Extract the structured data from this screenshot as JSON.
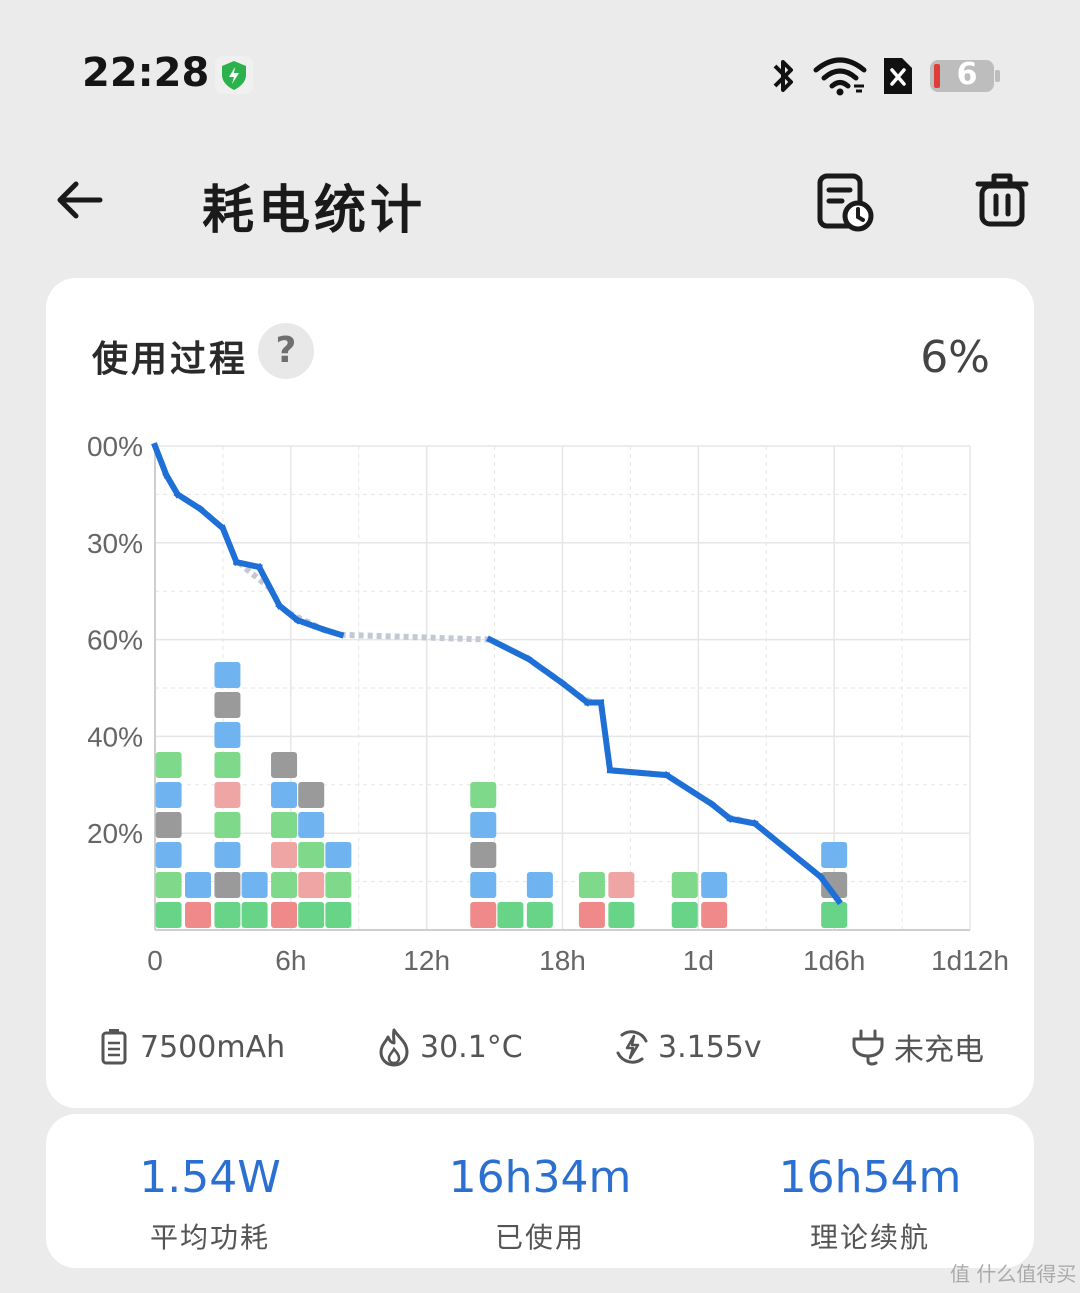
{
  "status_bar": {
    "time": "22:28",
    "battery_level": "6",
    "icons": [
      "shield-check-icon",
      "bluetooth-icon",
      "wifi-icon",
      "sim-error-icon",
      "battery-low-icon"
    ]
  },
  "header": {
    "title": "耗电统计",
    "back_icon": "arrow-left-icon",
    "actions": [
      "history-record-icon",
      "trash-icon"
    ]
  },
  "usage": {
    "title": "使用过程",
    "help": "?",
    "current_percent": "6%"
  },
  "chart_data": {
    "type": "line",
    "xlabel": "",
    "ylabel": "",
    "x_ticks": [
      "0",
      "6h",
      "12h",
      "18h",
      "1d",
      "1d6h",
      "1d12h"
    ],
    "y_ticks": [
      "00%",
      "30%",
      "60%",
      "40%",
      "20%"
    ],
    "xlim_hours": [
      0,
      36
    ],
    "ylim": [
      0,
      100
    ],
    "series": [
      {
        "values_hours": [
          0,
          0.5,
          1,
          2,
          3,
          3.6,
          4.6,
          5.5,
          6.3,
          7.5,
          8.2,
          11,
          14.8,
          16.5,
          18,
          19.1,
          19.7,
          20.1,
          22.6,
          24.6,
          25.4,
          26.5,
          29.4,
          30.2
        ],
        "values_percent": [
          100,
          94,
          90,
          87,
          83,
          76,
          75,
          67,
          64,
          62,
          61,
          60,
          60,
          56,
          51,
          47,
          47,
          33,
          32,
          26,
          23,
          22,
          11,
          6
        ],
        "dashed_idle_segments_hours": [
          [
            3.7,
            5.1
          ],
          [
            5.9,
            7.4
          ],
          [
            8.2,
            14.8
          ],
          [
            18.7,
            19.3
          ],
          [
            20.2,
            22.5
          ],
          [
            25.3,
            26.3
          ]
        ]
      }
    ],
    "app_markers": [
      {
        "hour": 0.6,
        "stack": 5
      },
      {
        "hour": 1.9,
        "stack": 1
      },
      {
        "hour": 3.2,
        "stack": 8
      },
      {
        "hour": 4.4,
        "stack": 1
      },
      {
        "hour": 5.7,
        "stack": 5
      },
      {
        "hour": 6.9,
        "stack": 4
      },
      {
        "hour": 8.1,
        "stack": 2
      },
      {
        "hour": 14.5,
        "stack": 4
      },
      {
        "hour": 15.7,
        "stack": 0
      },
      {
        "hour": 17.0,
        "stack": 1
      },
      {
        "hour": 19.3,
        "stack": 1
      },
      {
        "hour": 20.6,
        "stack": 1
      },
      {
        "hour": 23.4,
        "stack": 1
      },
      {
        "hour": 24.7,
        "stack": 1
      },
      {
        "hour": 30.0,
        "stack": 2
      }
    ]
  },
  "battery_info": [
    {
      "icon": "battery-capacity-icon",
      "text": "7500mAh"
    },
    {
      "icon": "flame-icon",
      "text": "30.1°C"
    },
    {
      "icon": "voltage-icon",
      "text": "3.155v"
    },
    {
      "icon": "plug-icon",
      "text": "未充电"
    }
  ],
  "stats": [
    {
      "value": "1.54W",
      "label": "平均功耗"
    },
    {
      "value": "16h34m",
      "label": "已使用"
    },
    {
      "value": "16h54m",
      "label": "理论续航"
    }
  ],
  "watermark": "值 什么值得买",
  "colors": {
    "line": "#1e6fd6",
    "idle": "#c8cdd6",
    "accent": "#2b6fd0",
    "background": "#ebebeb"
  }
}
